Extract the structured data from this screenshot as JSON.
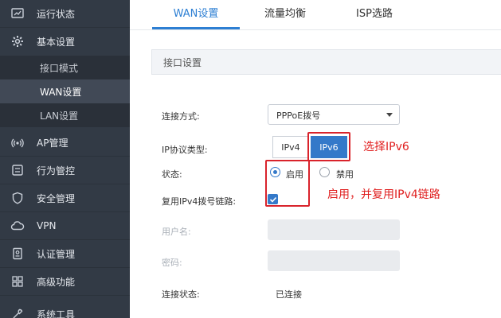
{
  "sidebar": {
    "items": [
      {
        "label": "运行状态",
        "icon": "dashboard-icon"
      },
      {
        "label": "基本设置",
        "icon": "gear-icon"
      },
      {
        "label": "AP管理",
        "icon": "ap-signal-icon"
      },
      {
        "label": "行为管控",
        "icon": "control-icon"
      },
      {
        "label": "安全管理",
        "icon": "shield-icon"
      },
      {
        "label": "VPN",
        "icon": "cloud-icon"
      },
      {
        "label": "认证管理",
        "icon": "auth-icon"
      },
      {
        "label": "高级功能",
        "icon": "grid-icon"
      },
      {
        "label": "系统工具",
        "icon": "tools-icon"
      }
    ],
    "sub_items": [
      {
        "label": "接口模式"
      },
      {
        "label": "WAN设置"
      },
      {
        "label": "LAN设置"
      }
    ]
  },
  "tabs": [
    {
      "label": "WAN设置"
    },
    {
      "label": "流量均衡"
    },
    {
      "label": "ISP选路"
    }
  ],
  "section": {
    "title": "接口设置"
  },
  "form": {
    "conn_type_label": "连接方式:",
    "conn_type_value": "PPPoE拨号",
    "ip_protocol_label": "IP协议类型:",
    "ipv4": "IPv4",
    "ipv6": "IPv6",
    "status_label": "状态:",
    "enable": "启用",
    "disable": "禁用",
    "multiplex_label": "复用IPv4拨号链路:",
    "username_label": "用户名:",
    "password_label": "密码:",
    "conn_status_label": "连接状态:",
    "conn_status_value": "已连接"
  },
  "annotations": {
    "ipv6_note": "选择IPv6",
    "enable_note": "启用，并复用IPv4链路"
  },
  "colors": {
    "sidebar_bg": "#323a45",
    "accent": "#3479c9",
    "annotation_red": "#e02020"
  }
}
